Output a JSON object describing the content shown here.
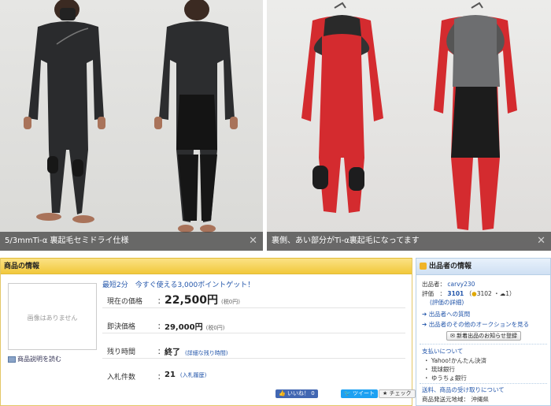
{
  "photos": {
    "left_caption": "5/3mmTi-α 裏起毛セミドライ仕様",
    "right_caption": "裏側、あい部分がTi-α裏起毛になってます",
    "close_glyph": "✕"
  },
  "product": {
    "header": "商品の情報",
    "no_image": "画像はありません",
    "read_description": "商品説明を読む",
    "promo": "最短2分　今すぐ使える3,000ポイントゲット！",
    "rows": {
      "current_price": {
        "label": "現在の価格",
        "value": "22,500円",
        "sub": "(税0円)"
      },
      "buyout_price": {
        "label": "即決価格",
        "value": "29,000円",
        "sub": "(税0円)"
      },
      "time_left": {
        "label": "残り時間",
        "value": "終了",
        "link": "(詳細な残り時間)"
      },
      "bids": {
        "label": "入札件数",
        "value": "21",
        "link": "(入札履歴)"
      }
    },
    "social": {
      "like": "いいね！",
      "like_count": "0",
      "tweet": "ツイート",
      "check": "チェック"
    }
  },
  "seller": {
    "header": "出品者の情報",
    "seller_label": "出品者：",
    "seller_name": "carvy230",
    "rating_label": "評価",
    "rating_value": "3101",
    "rating_good": "3102",
    "rating_bad": "1",
    "rating_detail": "(評価の詳細)",
    "ask_question": "出品者への質問",
    "other_auctions": "出品者のその他のオークションを見る",
    "notify_button": "新着出品のお知らせ登録",
    "payment_title": "支払いについて",
    "payments": [
      "Yahoo!かんたん決済",
      "琉球銀行",
      "ゆうちょ銀行"
    ],
    "shipping_title": "送料、商品の受け取りについて",
    "ship_from_label": "商品発送元地域：",
    "ship_from": "沖縄県"
  },
  "colors": {
    "header_yellow": "#f1c83b",
    "seller_blue": "#cfe0f3",
    "link": "#2255aa",
    "wetsuit_red": "#d42b2f",
    "wetsuit_black": "#1f1f20"
  }
}
